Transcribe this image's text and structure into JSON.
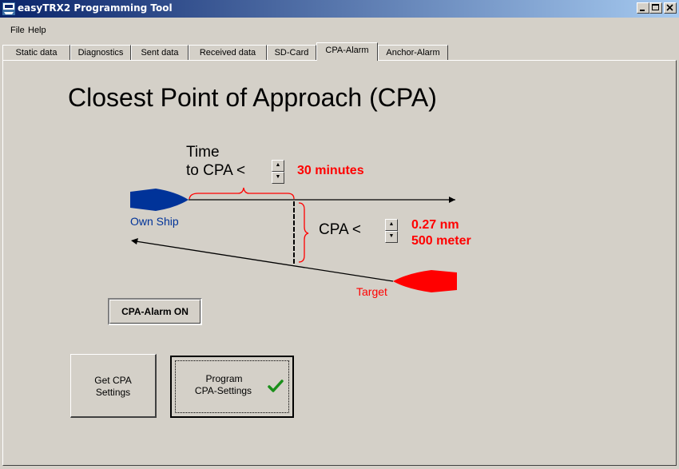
{
  "window": {
    "title": "easyTRX2 Programming Tool",
    "icon": "app-icon"
  },
  "menu": [
    "File",
    "Help"
  ],
  "tabs": [
    "Static data",
    "Diagnostics",
    "Sent data",
    "Received data",
    "SD-Card",
    "CPA-Alarm",
    "Anchor-Alarm"
  ],
  "active_tab": "CPA-Alarm",
  "heading": "Closest Point of Approach (CPA)",
  "diagram": {
    "time_label_1": "Time",
    "time_label_2": "to CPA  <",
    "time_value": "30 minutes",
    "cpa_label": "CPA  <",
    "cpa_value_nm": "0.27 nm",
    "cpa_value_m": "500 meter",
    "own_ship": "Own Ship",
    "target": "Target",
    "colors": {
      "own_ship": "#003399",
      "target": "#ff0000",
      "value_text": "#ff0000"
    }
  },
  "alarm_switch": "CPA-Alarm ON",
  "buttons": {
    "get_line1": "Get CPA",
    "get_line2": "Settings",
    "program_line1": "Program",
    "program_line2": "CPA-Settings"
  }
}
